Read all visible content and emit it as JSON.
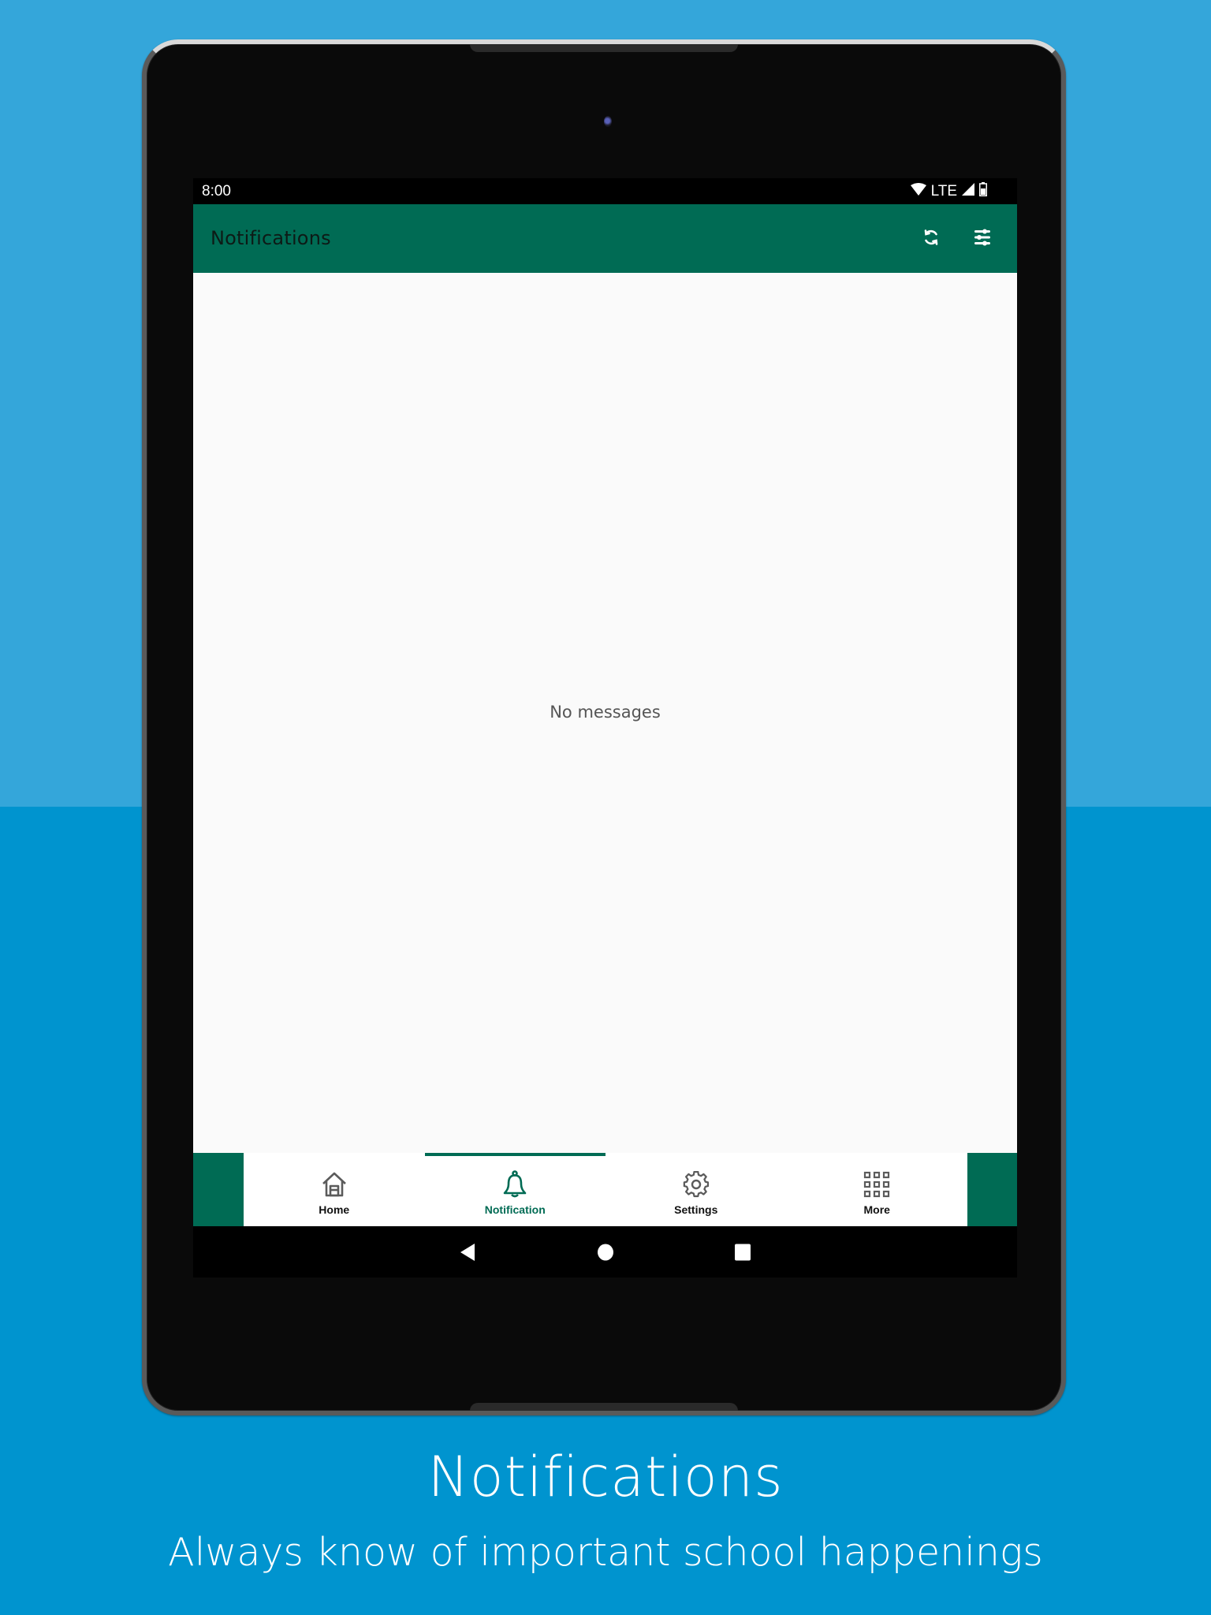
{
  "status_bar": {
    "time": "8:00",
    "network": "LTE",
    "icons": [
      "wifi-icon",
      "signal-icon",
      "battery-icon"
    ]
  },
  "toolbar": {
    "title": "Notifications",
    "actions": [
      {
        "name": "refresh",
        "icon": "refresh-icon"
      },
      {
        "name": "filter",
        "icon": "sliders-icon"
      }
    ]
  },
  "content": {
    "empty_message": "No messages"
  },
  "bottom_nav": {
    "active_index": 1,
    "items": [
      {
        "label": "Home",
        "icon": "home-icon"
      },
      {
        "label": "Notification",
        "icon": "bell-icon"
      },
      {
        "label": "Settings",
        "icon": "gear-icon"
      },
      {
        "label": "More",
        "icon": "grid-icon"
      }
    ]
  },
  "system_nav": {
    "buttons": [
      "back",
      "home",
      "recents"
    ]
  },
  "caption": {
    "title": "Notifications",
    "subtitle": "Always know of important school happenings"
  },
  "colors": {
    "brand_green": "#006b54",
    "background_top": "#34a6da",
    "background_bottom": "#0094cf"
  }
}
